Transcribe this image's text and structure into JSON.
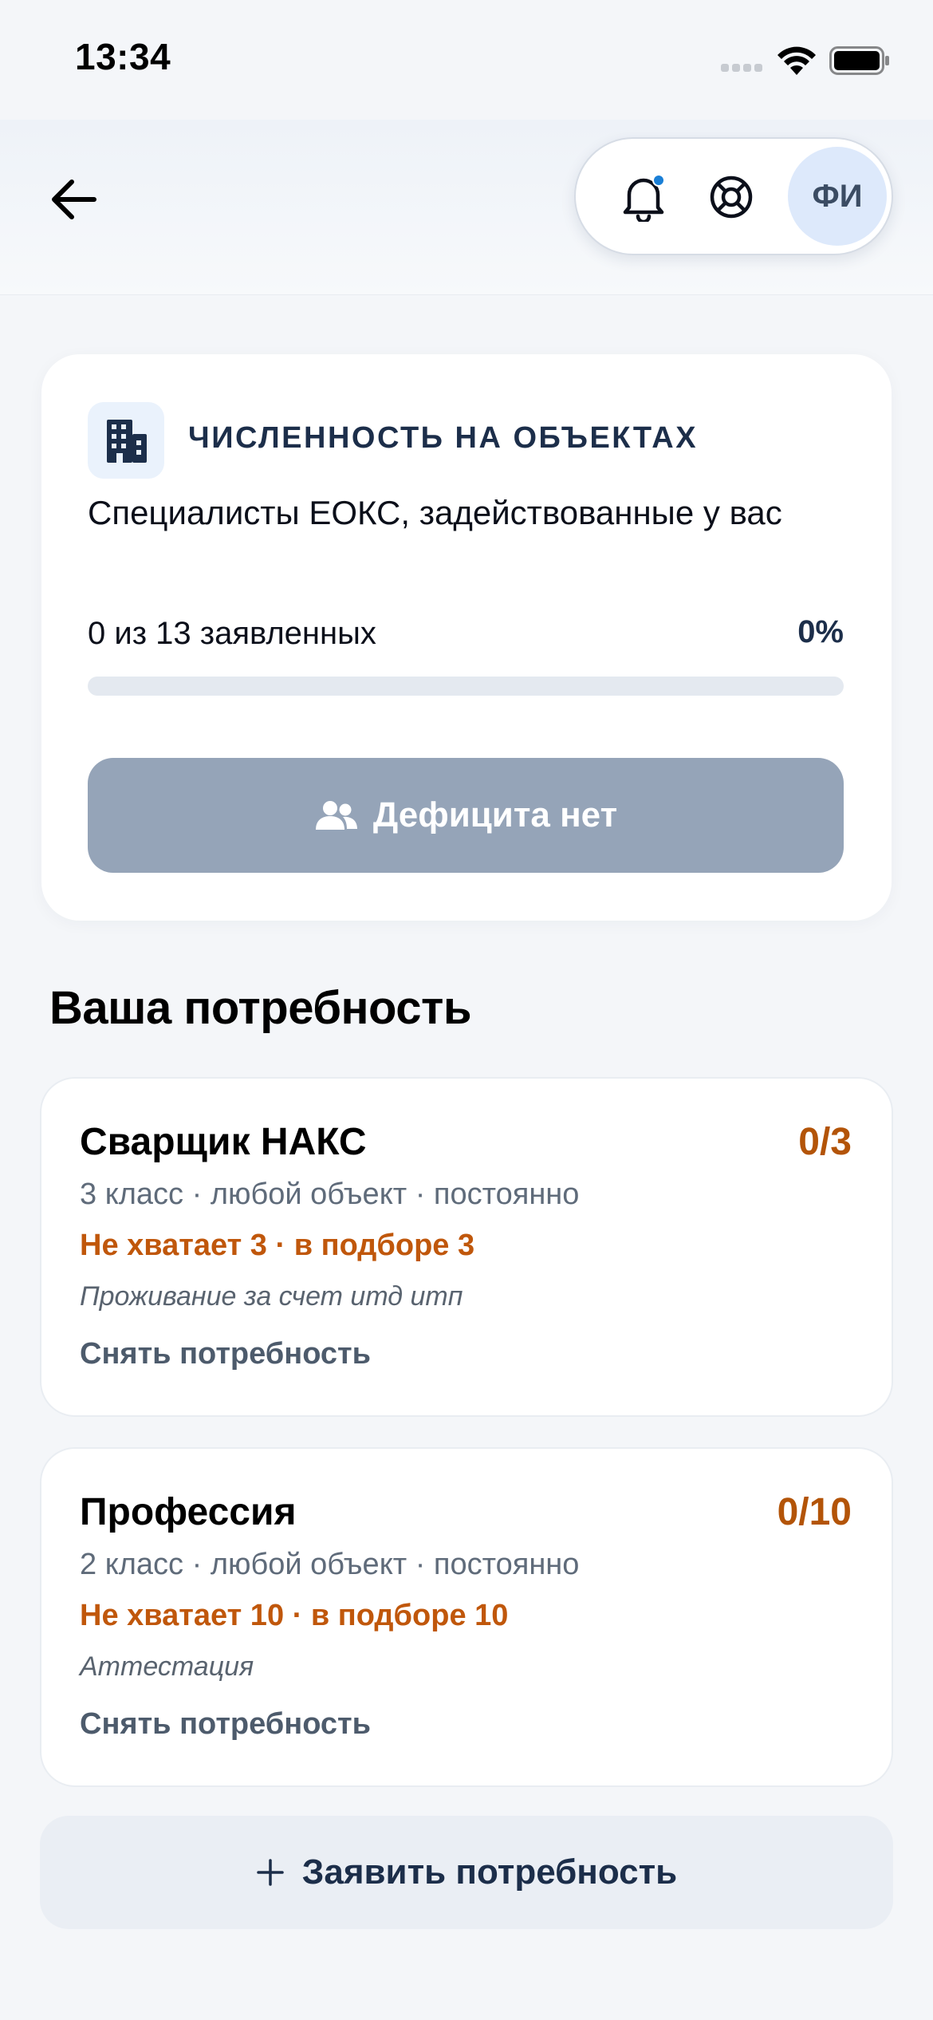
{
  "status_bar": {
    "time": "13:34",
    "icons": [
      "signal-icon",
      "wifi-icon",
      "battery-icon"
    ]
  },
  "header": {
    "back_icon": "arrow-left-icon",
    "has_notification": true,
    "actions": [
      "bell-icon",
      "support-lifebuoy-icon"
    ],
    "avatar_initials": "ФИ"
  },
  "staffing_card": {
    "icon": "building-icon",
    "kicker": "ЧИСЛЕННОСТЬ НА ОБЪЕКТАХ",
    "description": "Специалисты ЕОКС, задействованные у вас",
    "progress_label": "0 из 13 заявленных",
    "progress_percent_text": "0%",
    "progress_value": 0,
    "button_icon": "people-icon",
    "button_label": "Дефицита нет"
  },
  "section_title": "Ваша потребность",
  "needs": [
    {
      "title": "Сварщик НАКС",
      "count": "0/3",
      "meta": "3 класс · любой объект · постоянно",
      "shortage": "Не хватает 3 · в подборе 3",
      "note": "Проживание за счет итд итп",
      "remove_label": "Снять потребность"
    },
    {
      "title": "Профессия",
      "count": "0/10",
      "meta": "2 класс · любой объект · постоянно",
      "shortage": "Не хватает 10 · в подборе 10",
      "note": "Аттестация",
      "remove_label": "Снять потребность"
    }
  ],
  "add_need": {
    "icon": "plus-icon",
    "label": "Заявить потребность"
  },
  "colors": {
    "background": "#f4f6f9",
    "accent_dark": "#1c2e4a",
    "warning_orange": "#c0570b",
    "disabled_button": "#95a4b8",
    "notification_dot": "#1a7fd6"
  }
}
